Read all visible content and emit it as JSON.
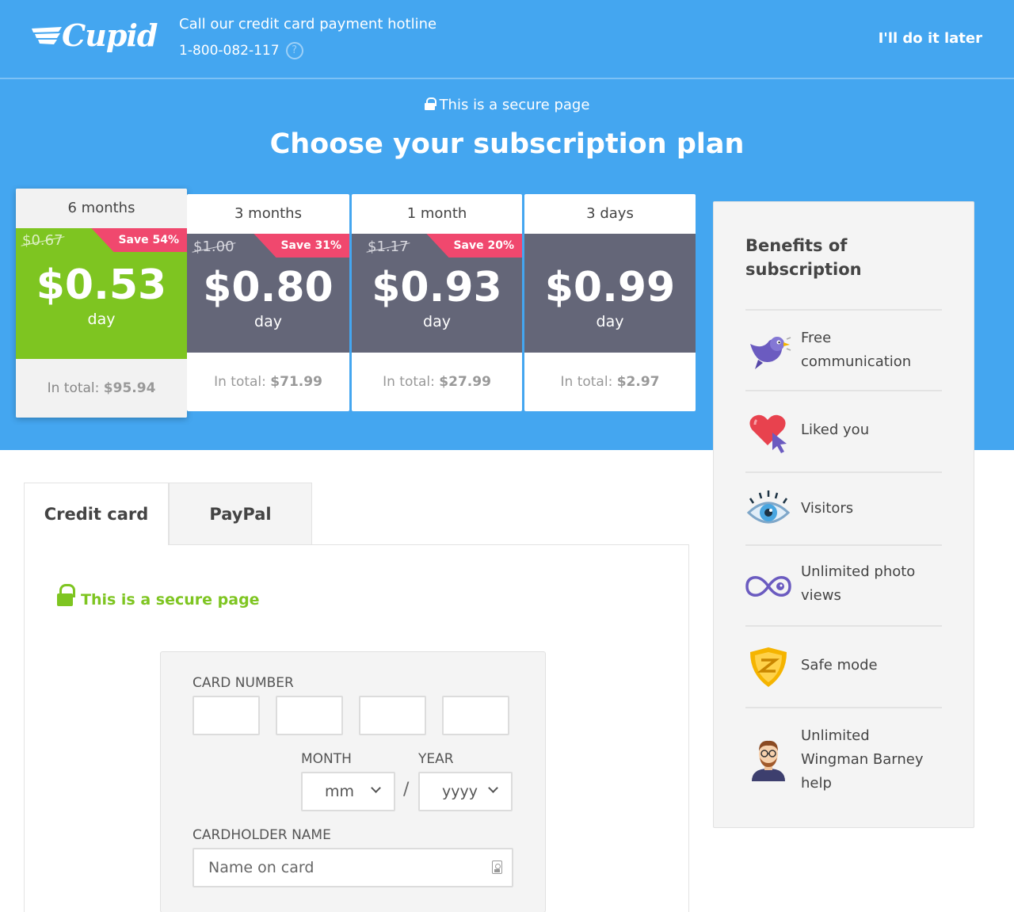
{
  "header": {
    "logo_text": "Cupid",
    "hotline_label": "Call our credit card payment hotline",
    "hotline_phone": "1-800-082-117",
    "later_link": "I'll do it later"
  },
  "hero": {
    "secure_text": "This is a secure page",
    "title": "Choose your subscription plan"
  },
  "plans": [
    {
      "duration": "6 months",
      "old_price": "$0.67",
      "save": "Save 54%",
      "price": "$0.53",
      "per": "day",
      "total_label": "In total:",
      "total": "$95.94",
      "selected": true
    },
    {
      "duration": "3 months",
      "old_price": "$1.00",
      "save": "Save 31%",
      "price": "$0.80",
      "per": "day",
      "total_label": "In total:",
      "total": "$71.99",
      "selected": false
    },
    {
      "duration": "1 month",
      "old_price": "$1.17",
      "save": "Save 20%",
      "price": "$0.93",
      "per": "day",
      "total_label": "In total:",
      "total": "$27.99",
      "selected": false
    },
    {
      "duration": "3 days",
      "price": "$0.99",
      "per": "day",
      "total_label": "In total:",
      "total": "$2.97",
      "selected": false
    }
  ],
  "benefits": {
    "title": "Benefits of subscription",
    "items": [
      {
        "label": "Free communication",
        "icon": "bird-icon"
      },
      {
        "label": "Liked you",
        "icon": "heart-cursor-icon"
      },
      {
        "label": "Visitors",
        "icon": "eye-icon"
      },
      {
        "label": "Unlimited photo views",
        "icon": "infinity-eye-icon"
      },
      {
        "label": "Safe mode",
        "icon": "shield-icon"
      },
      {
        "label": "Unlimited Wingman Barney help",
        "icon": "wingman-avatar-icon"
      }
    ]
  },
  "payment": {
    "tabs": [
      {
        "label": "Credit card",
        "active": true
      },
      {
        "label": "PayPal",
        "active": false
      }
    ],
    "secure_text": "This is a secure page",
    "card_number_label": "CARD NUMBER",
    "month_label": "MONTH",
    "year_label": "YEAR",
    "month_value": "mm",
    "year_value": "yyyy",
    "date_separator": "/",
    "cardholder_label": "CARDHOLDER NAME",
    "cardholder_placeholder": "Name on card"
  },
  "colors": {
    "header_blue": "#44a6f0",
    "selected_green": "#7ec521",
    "plan_gray": "#646678",
    "save_pink": "#f0486e"
  }
}
